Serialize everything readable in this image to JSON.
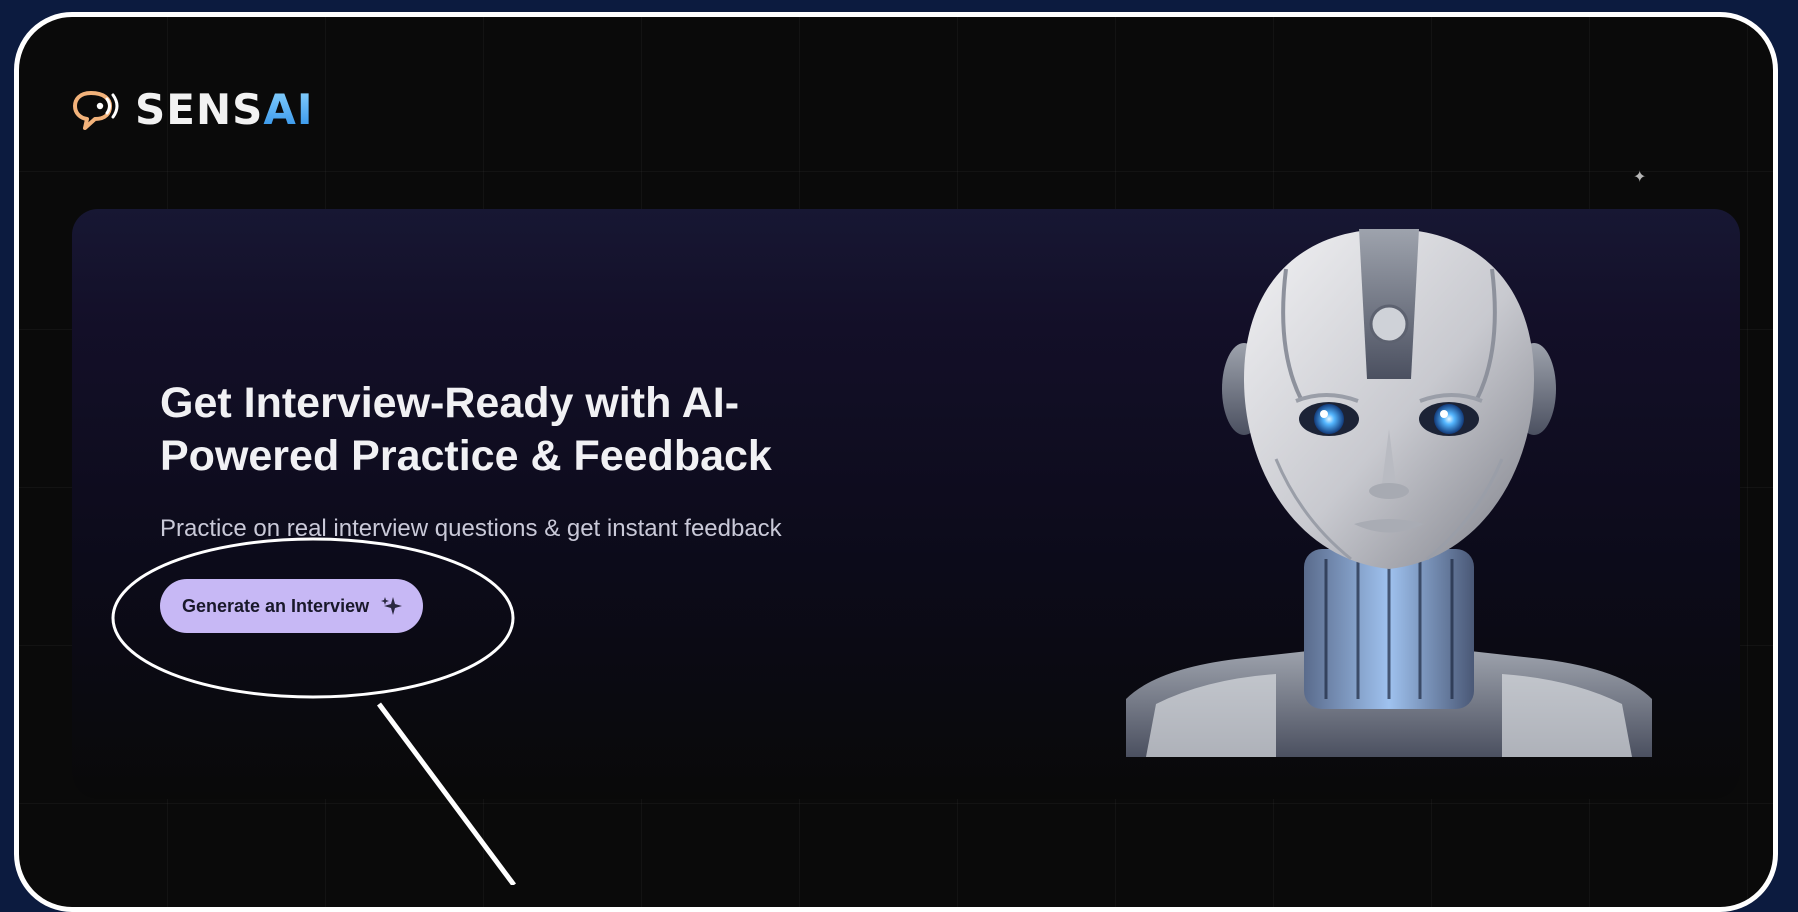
{
  "brand": {
    "name_prefix": "SENS",
    "name_suffix": "AI",
    "icon": "chat-bubble-sound-icon"
  },
  "hero": {
    "title": "Get Interview-Ready with AI-Powered Practice & Feedback",
    "subtitle": "Practice on real interview questions & get instant feedback",
    "cta_label": "Generate an Interview",
    "cta_icon": "sparkle-icon",
    "image": "humanoid-robot-illustration"
  },
  "colors": {
    "outer_background": "#0c1b3f",
    "frame_border": "#ffffff",
    "page_background": "#0a0a0a",
    "hero_gradient_top": "#171733",
    "cta_background": "#c7b8f5",
    "brand_ai_accent": "#2b8ee8",
    "logo_icon_accent": "#f2b27a"
  }
}
